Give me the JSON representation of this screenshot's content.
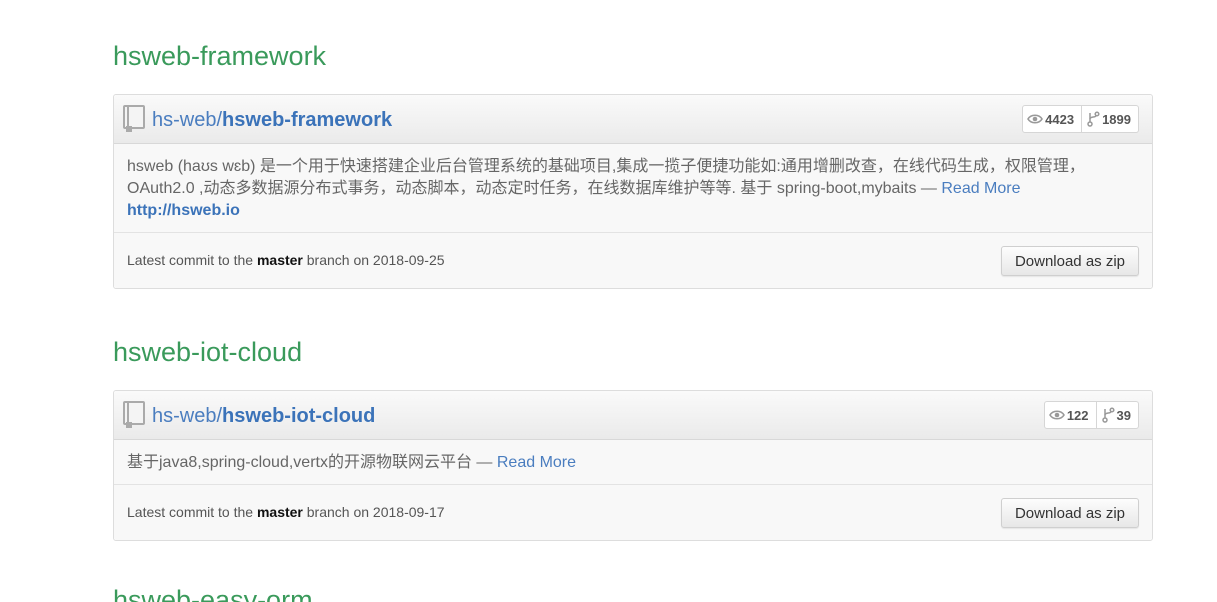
{
  "repos": [
    {
      "section_title": "hsweb-framework",
      "owner": "hs-web",
      "separator": "/",
      "name": "hsweb-framework",
      "watchers": "4423",
      "forks": "1899",
      "description": "hsweb (haʊs wɛb) 是一个用于快速搭建企业后台管理系统的基础项目,集成一揽子便捷功能如:通用增删改查，在线代码生成，权限管理，OAuth2.0 ,动态多数据源分布式事务，动态脚本，动态定时任务，在线数据库维护等等. 基于 spring-boot,mybaits —",
      "read_more": "Read More",
      "homepage": "http://hsweb.io",
      "commit_prefix": "Latest commit to the",
      "branch": "master",
      "commit_suffix": "branch on 2018-09-25",
      "download_label": "Download as zip"
    },
    {
      "section_title": "hsweb-iot-cloud",
      "owner": "hs-web",
      "separator": "/",
      "name": "hsweb-iot-cloud",
      "watchers": "122",
      "forks": "39",
      "description": "基于java8,spring-cloud,vertx的开源物联网云平台 —",
      "read_more": "Read More",
      "commit_prefix": "Latest commit to the",
      "branch": "master",
      "commit_suffix": "branch on 2018-09-17",
      "download_label": "Download as zip"
    },
    {
      "section_title": "hsweb-easy-orm"
    }
  ],
  "colors": {
    "section_title": "#3a9a5b",
    "link": "#4a7dbf",
    "header_bg": "#f0f0f0"
  },
  "icons": {
    "repo": "repo-book-icon",
    "watchers": "eye-icon",
    "forks": "fork-icon"
  }
}
